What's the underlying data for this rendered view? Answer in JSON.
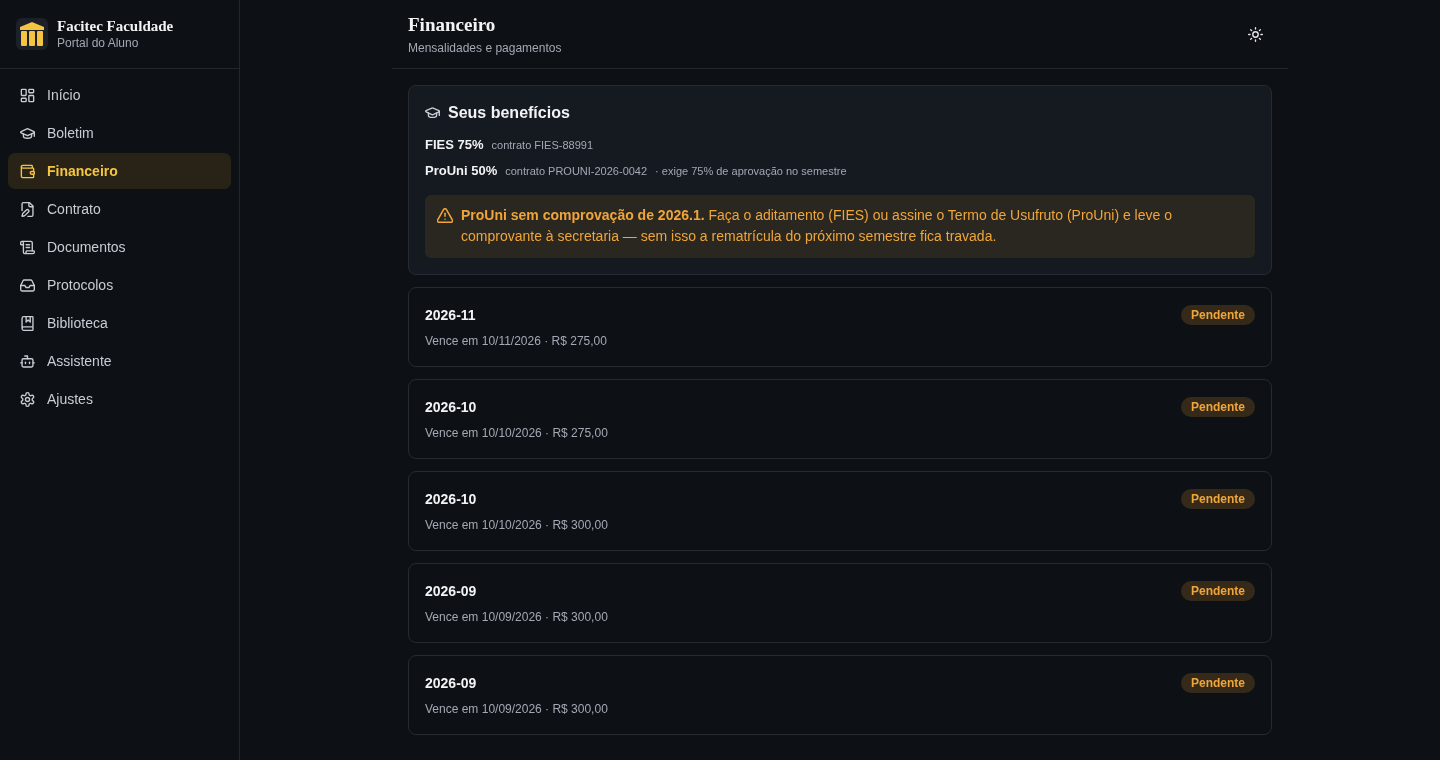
{
  "sidebar": {
    "brand": {
      "name": "Facitec Faculdade",
      "subtitle": "Portal do Aluno"
    },
    "items": [
      {
        "label": "Início",
        "selected": false
      },
      {
        "label": "Boletim",
        "selected": false
      },
      {
        "label": "Financeiro",
        "selected": true
      },
      {
        "label": "Contrato",
        "selected": false
      },
      {
        "label": "Documentos",
        "selected": false
      },
      {
        "label": "Protocolos",
        "selected": false
      },
      {
        "label": "Biblioteca",
        "selected": false
      },
      {
        "label": "Assistente",
        "selected": false
      },
      {
        "label": "Ajustes",
        "selected": false
      }
    ]
  },
  "header": {
    "title": "Financeiro",
    "subtitle": "Mensalidades e pagamentos"
  },
  "benefits": {
    "title": "Seus benefícios",
    "items": [
      {
        "name": "FIES 75%",
        "contract": "contrato FIES-88991"
      },
      {
        "name": "ProUni 50%",
        "contract": "contrato PROUNI-2026-0042",
        "note": "· exige 75% de aprovação no semestre"
      }
    ],
    "alert": {
      "text": "**ProUni sem comprovação de 2026.1.** Faça o aditamento (FIES) ou assine o Termo de Usufruto (ProUni) e leve o comprovante à secretaria — sem isso a rematrícula do próximo semestre fica travada."
    }
  },
  "payments": [
    {
      "period": "2026-11",
      "details": "Vence em 10/11/2026 · R$ 275,00",
      "status": "Pendente"
    },
    {
      "period": "2026-10",
      "details": "Vence em 10/10/2026 · R$ 275,00",
      "status": "Pendente"
    },
    {
      "period": "2026-10",
      "details": "Vence em 10/10/2026 · R$ 300,00",
      "status": "Pendente"
    },
    {
      "period": "2026-09",
      "details": "Vence em 10/09/2026 · R$ 300,00",
      "status": "Pendente"
    },
    {
      "period": "2026-09",
      "details": "Vence em 10/09/2026 · R$ 300,00",
      "status": "Pendente"
    }
  ]
}
